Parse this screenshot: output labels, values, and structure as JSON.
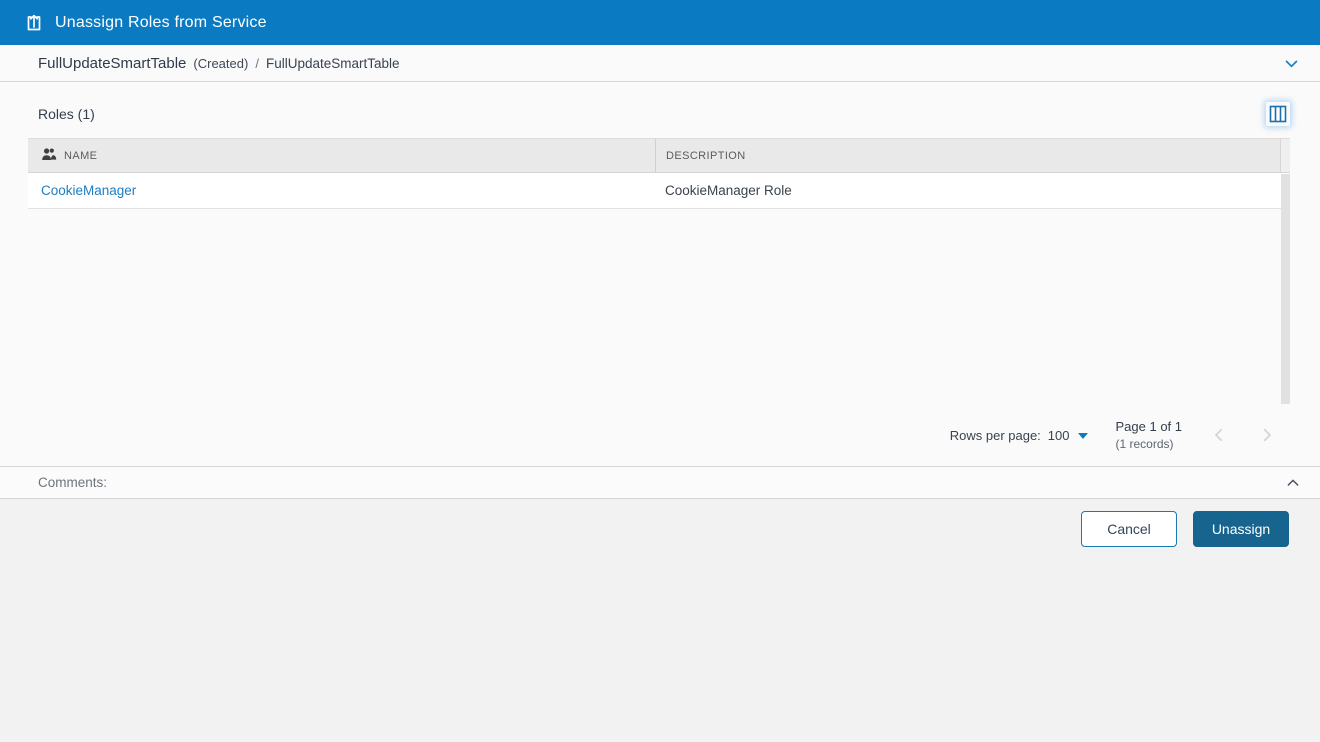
{
  "header": {
    "title": "Unassign Roles from Service",
    "icon": "unassign-export-icon"
  },
  "breadcrumb": {
    "primary": "FullUpdateSmartTable",
    "status": "(Created)",
    "separator": "/",
    "secondary": "FullUpdateSmartTable",
    "collapse_icon": "chevron-down-icon"
  },
  "roles": {
    "section_title": "Roles (1)",
    "column_settings_icon": "columns-icon",
    "table": {
      "columns": [
        {
          "label": "NAME",
          "icon": "users-icon"
        },
        {
          "label": "DESCRIPTION"
        }
      ],
      "rows": [
        {
          "name": "CookieManager",
          "description": "CookieManager Role"
        }
      ]
    },
    "pagination": {
      "rows_per_page_label": "Rows per page:",
      "rows_per_page_value": "100",
      "page_label": "Page 1 of 1",
      "records_label": "(1 records)",
      "prev_icon": "chevron-left-icon",
      "next_icon": "chevron-right-icon"
    }
  },
  "comments": {
    "label": "Comments:",
    "collapse_icon": "chevron-up-icon"
  },
  "footer": {
    "cancel_label": "Cancel",
    "unassign_label": "Unassign"
  },
  "colors": {
    "header_blue": "#0a7bc2",
    "link_blue": "#1f7dc1",
    "unassign_button_blue": "#17658f",
    "cancel_border_blue": "#1879b5",
    "table_header_gray": "#e9e9e9",
    "page_background": "#fafafa",
    "footer_background": "#f2f2f2"
  }
}
